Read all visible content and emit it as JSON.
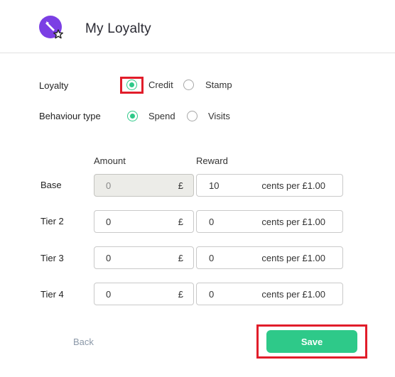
{
  "header": {
    "title": "My Loyalty",
    "logo_icon": "loyalty-star-icon",
    "logo_color": "#7b3fe4"
  },
  "loyalty": {
    "label": "Loyalty",
    "options": [
      {
        "label": "Credit",
        "selected": true
      },
      {
        "label": "Stamp",
        "selected": false
      }
    ]
  },
  "behaviour": {
    "label": "Behaviour type",
    "options": [
      {
        "label": "Spend",
        "selected": true
      },
      {
        "label": "Visits",
        "selected": false
      }
    ]
  },
  "table": {
    "amount_header": "Amount",
    "reward_header": "Reward",
    "rows": [
      {
        "label": "Base",
        "amount": "0",
        "currency": "£",
        "reward": "10",
        "reward_suffix": "cents per £1.00",
        "amount_disabled": true
      },
      {
        "label": "Tier 2",
        "amount": "0",
        "currency": "£",
        "reward": "0",
        "reward_suffix": "cents per £1.00",
        "amount_disabled": false
      },
      {
        "label": "Tier 3",
        "amount": "0",
        "currency": "£",
        "reward": "0",
        "reward_suffix": "cents per £1.00",
        "amount_disabled": false
      },
      {
        "label": "Tier 4",
        "amount": "0",
        "currency": "£",
        "reward": "0",
        "reward_suffix": "cents per £1.00",
        "amount_disabled": false
      }
    ]
  },
  "actions": {
    "back_label": "Back",
    "save_label": "Save"
  },
  "colors": {
    "accent": "#2ec989",
    "highlight": "#e11d2a",
    "back_text": "#8b98a8"
  }
}
